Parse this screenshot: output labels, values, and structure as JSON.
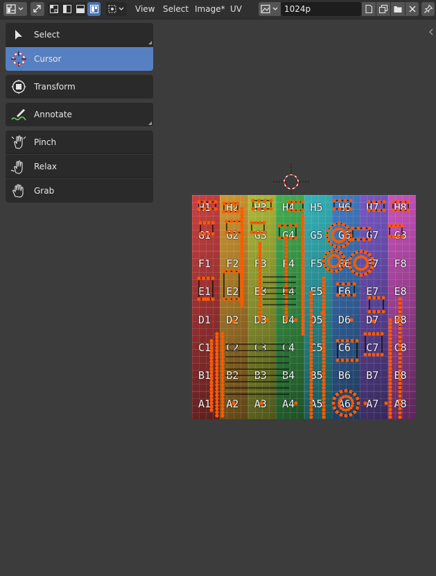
{
  "header": {
    "editor_type_icon": "uv-editor-icon",
    "sync_icon": "uv-sync-selection-icon",
    "select_mode_icons": [
      "vertex-select-icon",
      "edge-select-icon",
      "face-select-icon",
      "island-select-icon"
    ],
    "pivot_icon": "pivot-point-icon",
    "menus": [
      "View",
      "Select",
      "Image*",
      "UV"
    ],
    "image_browse_icon": "image-browse-icon",
    "image_name": "1024p",
    "action_icons": [
      "new-image-icon",
      "duplicate-image-icon",
      "open-image-icon",
      "close-icon"
    ],
    "pin_icon": "pin-icon"
  },
  "toolbar": {
    "tools": [
      {
        "label": "Select",
        "icon": "select-arrow-icon",
        "active": false
      },
      {
        "label": "Cursor",
        "icon": "cursor-icon",
        "active": true
      },
      {
        "label": "Transform",
        "icon": "transform-icon",
        "active": false
      },
      {
        "label": "Annotate",
        "icon": "annotate-icon",
        "active": false
      },
      {
        "label": "Pinch",
        "icon": "pinch-icon",
        "active": false
      },
      {
        "label": "Relax",
        "icon": "relax-icon",
        "active": false
      },
      {
        "label": "Grab",
        "icon": "grab-icon",
        "active": false
      }
    ]
  },
  "uv_image": {
    "cell_labels": [
      [
        "H1",
        "H2",
        "H3",
        "H4",
        "H5",
        "H6",
        "H7",
        "H8"
      ],
      [
        "G1",
        "G2",
        "G3",
        "G4",
        "G5",
        "G6",
        "G7",
        "G8"
      ],
      [
        "F1",
        "F2",
        "F3",
        "F4",
        "F5",
        "F6",
        "F7",
        "F8"
      ],
      [
        "E1",
        "E2",
        "E3",
        "E4",
        "E5",
        "E6",
        "E7",
        "E8"
      ],
      [
        "D1",
        "D2",
        "D3",
        "D4",
        "D5",
        "D6",
        "D7",
        "D8"
      ],
      [
        "C1",
        "C2",
        "C3",
        "C4",
        "C5",
        "C6",
        "C7",
        "C8"
      ],
      [
        "B1",
        "B2",
        "B3",
        "B4",
        "B5",
        "B6",
        "B7",
        "B8"
      ],
      [
        "A1",
        "A2",
        "A3",
        "A4",
        "A5",
        "A6",
        "A7",
        "A8"
      ]
    ],
    "column_colors": [
      "#b33a3a",
      "#b8862e",
      "#9aa634",
      "#3c9c4a",
      "#2f9fa4",
      "#3a6fb0",
      "#6a4fb0",
      "#b24aa8"
    ],
    "vertex_color": "#ff5a00",
    "edge_color": "#000000"
  },
  "colors": {
    "active_tool": "#5680c2",
    "active_mode_button": "#4772b3",
    "cursor_ring": "#ff3030"
  }
}
